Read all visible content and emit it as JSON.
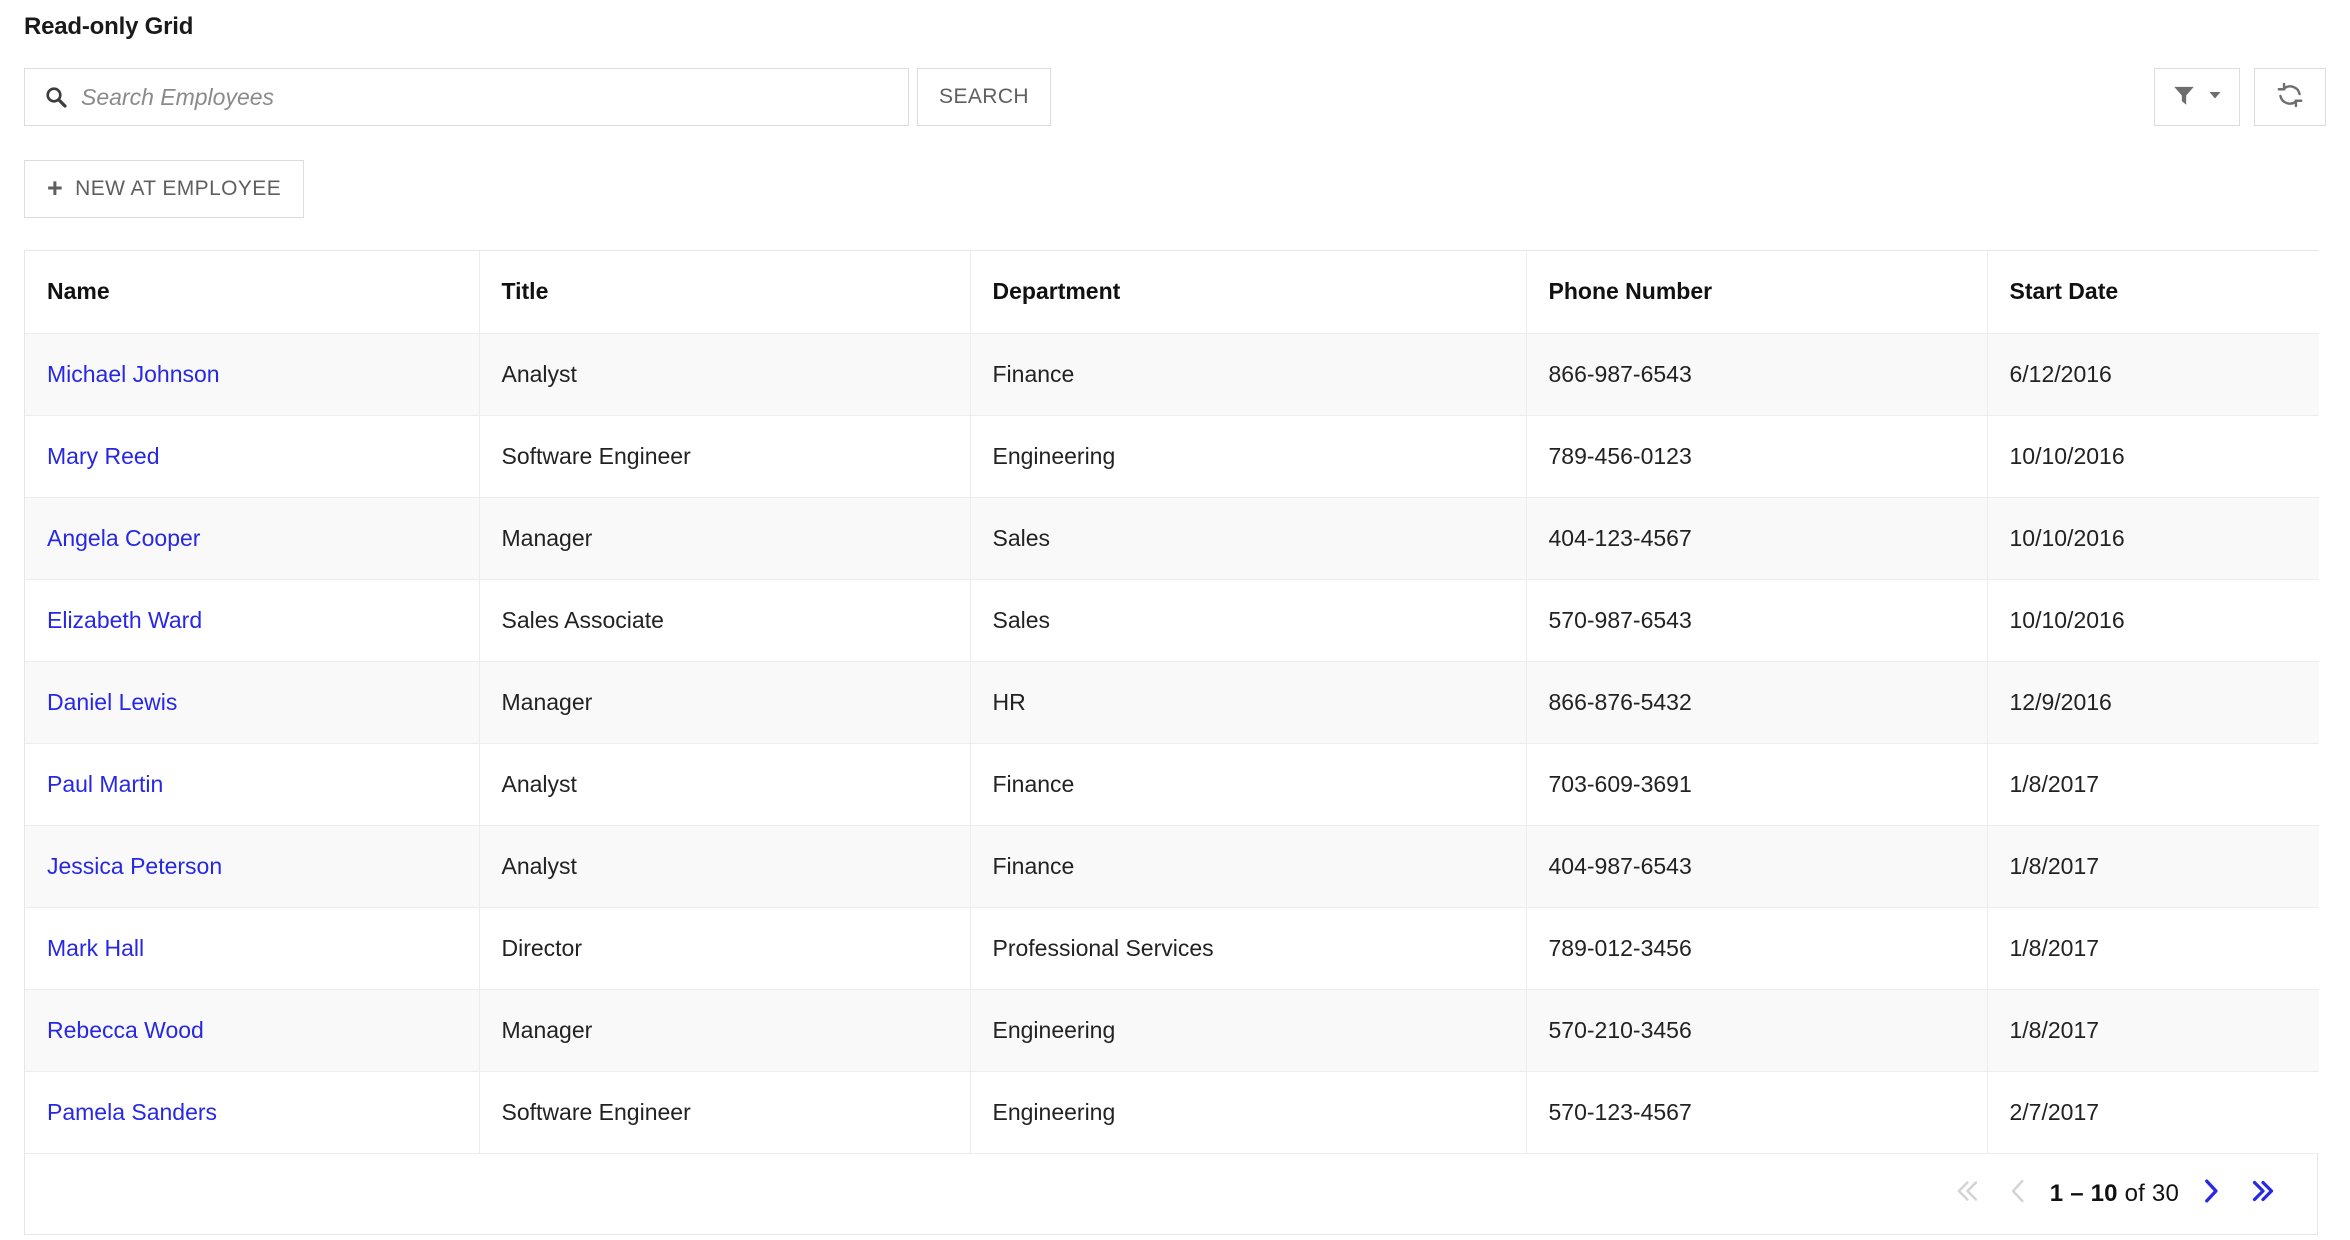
{
  "page": {
    "title": "Read-only Grid"
  },
  "colors": {
    "link": "#2727e6",
    "pager_enabled": "#2727e6",
    "pager_disabled": "#d4d4d4",
    "border": "#e6e6e6",
    "row_alt_bg": "#f9f9f9",
    "muted_text": "#5f5f5f"
  },
  "search": {
    "placeholder": "Search Employees",
    "value": "",
    "button_label": "SEARCH",
    "icon": "search-icon"
  },
  "toolbar": {
    "filter_icon": "filter-icon",
    "filter_caret_icon": "chevron-down-icon",
    "refresh_icon": "refresh-icon",
    "new_button_label": "NEW AT EMPLOYEE",
    "new_button_icon": "plus-icon"
  },
  "grid": {
    "columns": [
      {
        "label": "Name",
        "align": "left"
      },
      {
        "label": "Title",
        "align": "left"
      },
      {
        "label": "Department",
        "align": "left"
      },
      {
        "label": "Phone Number",
        "align": "left"
      },
      {
        "label": "Start Date",
        "align": "right"
      }
    ],
    "rows": [
      {
        "name": "Michael Johnson",
        "title": "Analyst",
        "department": "Finance",
        "phone": "866-987-6543",
        "start_date": "6/12/2016"
      },
      {
        "name": "Mary Reed",
        "title": "Software Engineer",
        "department": "Engineering",
        "phone": "789-456-0123",
        "start_date": "10/10/2016"
      },
      {
        "name": "Angela Cooper",
        "title": "Manager",
        "department": "Sales",
        "phone": "404-123-4567",
        "start_date": "10/10/2016"
      },
      {
        "name": "Elizabeth Ward",
        "title": "Sales Associate",
        "department": "Sales",
        "phone": "570-987-6543",
        "start_date": "10/10/2016"
      },
      {
        "name": "Daniel Lewis",
        "title": "Manager",
        "department": "HR",
        "phone": "866-876-5432",
        "start_date": "12/9/2016"
      },
      {
        "name": "Paul Martin",
        "title": "Analyst",
        "department": "Finance",
        "phone": "703-609-3691",
        "start_date": "1/8/2017"
      },
      {
        "name": "Jessica Peterson",
        "title": "Analyst",
        "department": "Finance",
        "phone": "404-987-6543",
        "start_date": "1/8/2017"
      },
      {
        "name": "Mark Hall",
        "title": "Director",
        "department": "Professional Services",
        "phone": "789-012-3456",
        "start_date": "1/8/2017"
      },
      {
        "name": "Rebecca Wood",
        "title": "Manager",
        "department": "Engineering",
        "phone": "570-210-3456",
        "start_date": "1/8/2017"
      },
      {
        "name": "Pamela Sanders",
        "title": "Software Engineer",
        "department": "Engineering",
        "phone": "570-123-4567",
        "start_date": "2/7/2017"
      }
    ]
  },
  "paginator": {
    "first_icon": "double-chevron-left-icon",
    "prev_icon": "chevron-left-icon",
    "next_icon": "chevron-right-icon",
    "last_icon": "double-chevron-right-icon",
    "range": "1 – 10",
    "total_text": "of 30",
    "first_enabled": false,
    "prev_enabled": false,
    "next_enabled": true,
    "last_enabled": true
  }
}
